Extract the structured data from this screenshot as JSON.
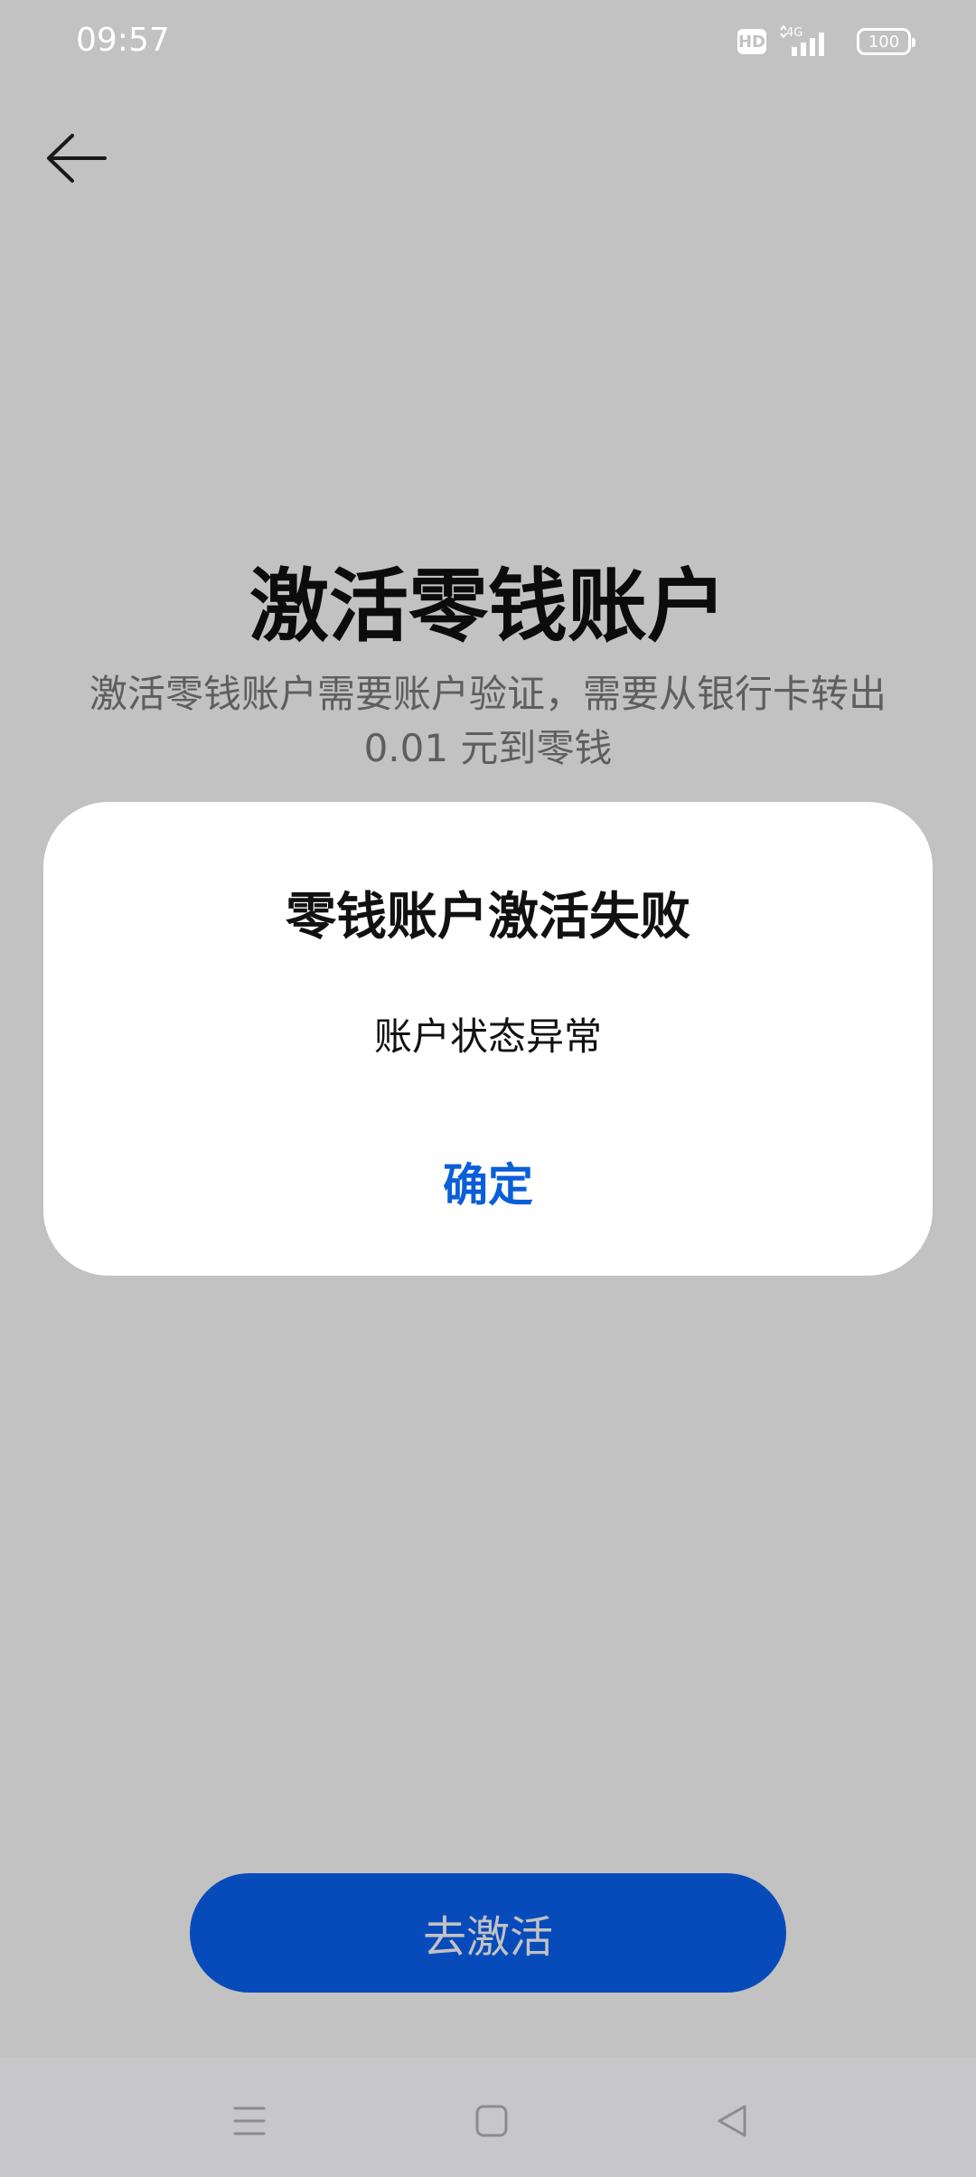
{
  "status_bar": {
    "time": "09:57",
    "hd_label": "HD",
    "network": "4G",
    "battery": "100"
  },
  "page": {
    "title": "激活零钱账户",
    "description": "激活零钱账户需要账户验证，需要从银行卡转出 0.01 元到零钱",
    "activate_button_label": "去激活"
  },
  "dialog": {
    "title": "零钱账户激活失败",
    "message": "账户状态异常",
    "confirm_label": "确定"
  },
  "colors": {
    "accent_blue": "#0a63f6",
    "dialog_link_blue": "#0a5fd8",
    "overlay": "rgba(0,0,0,0.24)"
  },
  "icons": {
    "back": "arrow-left-icon",
    "hd": "hd-icon",
    "signal": "signal-4g-icon",
    "battery": "battery-icon",
    "nav_menu": "menu-icon",
    "nav_home": "home-icon",
    "nav_back": "back-triangle-icon"
  }
}
